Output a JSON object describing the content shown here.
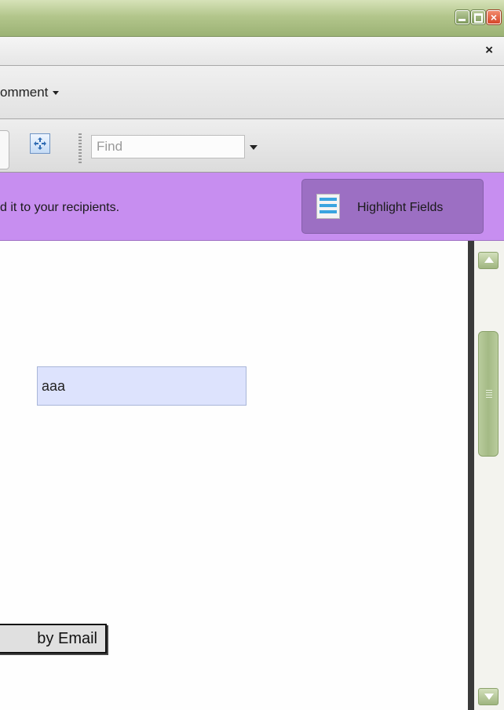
{
  "window": {
    "buttons": [
      "minimize",
      "maximize",
      "close"
    ],
    "accent_color": "#9bb274"
  },
  "tabbar": {
    "close_glyph": "×"
  },
  "menu": {
    "comment_label": "omment"
  },
  "toolbar": {
    "fit_icon": "fit-page-icon",
    "find_placeholder": "Find",
    "find_value": ""
  },
  "banner": {
    "message": "d it to your recipients.",
    "highlight_button_label": "Highlight Fields",
    "color": "#c78ef0"
  },
  "form": {
    "text_field_value": "aaa",
    "submit_button_label": "by Email"
  },
  "scrollbar": {
    "thumb_position_fraction": 0.2,
    "thumb_size_fraction": 0.27
  }
}
